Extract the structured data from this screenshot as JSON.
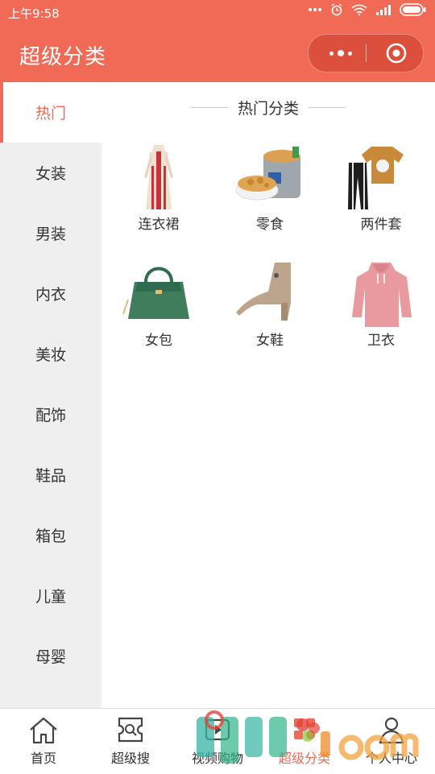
{
  "status_bar": {
    "time": "上午9:58"
  },
  "header": {
    "title": "超级分类"
  },
  "sidebar": {
    "items": [
      {
        "label": "热门",
        "active": true
      },
      {
        "label": "女装"
      },
      {
        "label": "男装"
      },
      {
        "label": "内衣"
      },
      {
        "label": "美妆"
      },
      {
        "label": "配饰"
      },
      {
        "label": "鞋品"
      },
      {
        "label": "箱包"
      },
      {
        "label": "儿童"
      },
      {
        "label": "母婴"
      }
    ]
  },
  "main": {
    "section_title": "热门分类",
    "categories": [
      {
        "label": "连衣裙",
        "icon": "dress-image"
      },
      {
        "label": "零食",
        "icon": "snack-image"
      },
      {
        "label": "两件套",
        "icon": "two-piece-set-image"
      },
      {
        "label": "女包",
        "icon": "handbag-image"
      },
      {
        "label": "女鞋",
        "icon": "ankle-boot-image"
      },
      {
        "label": "卫衣",
        "icon": "hoodie-image"
      }
    ]
  },
  "tabbar": {
    "items": [
      {
        "label": "首页",
        "icon": "home-icon"
      },
      {
        "label": "超级搜",
        "icon": "search-ticket-icon"
      },
      {
        "label": "视频购物",
        "icon": "video-icon"
      },
      {
        "label": "超级分类",
        "icon": "category-icon",
        "active": true
      },
      {
        "label": "个人中心",
        "icon": "user-icon"
      }
    ]
  },
  "colors": {
    "accent": "#f16a55",
    "sidebar_bg": "#efefef"
  }
}
